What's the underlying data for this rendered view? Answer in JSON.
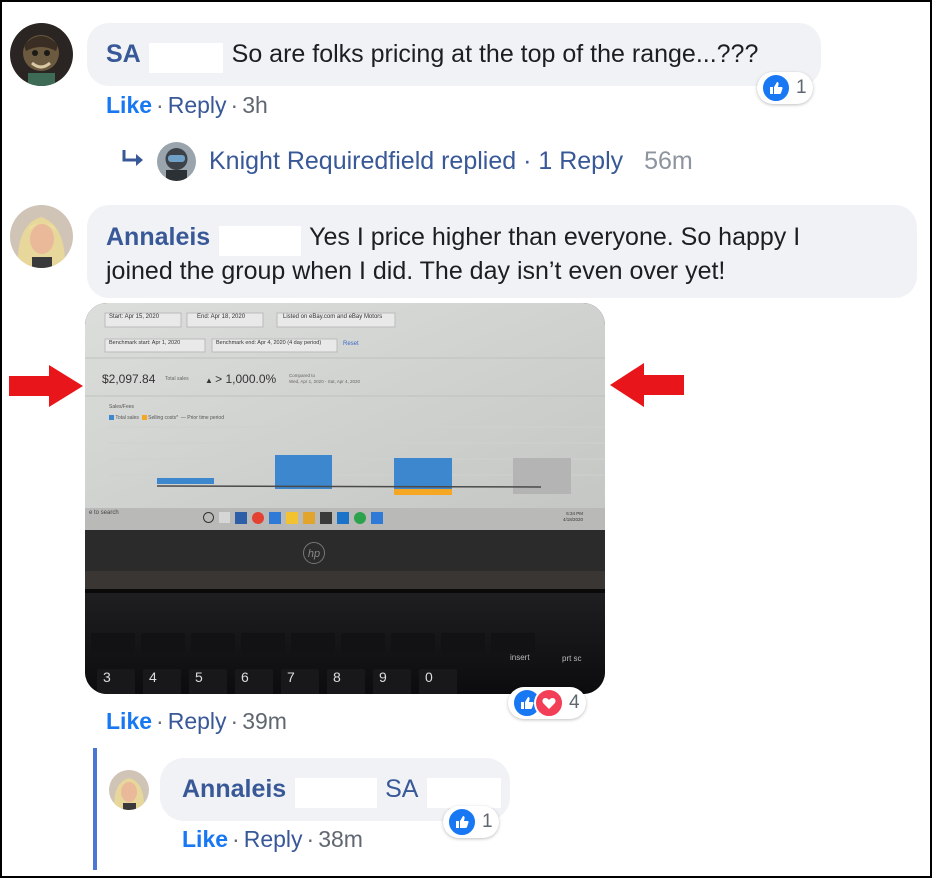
{
  "comments": [
    {
      "name": "SA",
      "text": "So are folks pricing at the top of the range...???",
      "like_label": "Like",
      "reply_label": "Reply",
      "time": "3h",
      "reaction_count": "1"
    },
    {
      "name": "Annaleis",
      "text_line1": "Yes I price higher than everyone. So happy I",
      "text_line2": "joined the group when I did. The day isn’t even over yet!",
      "like_label": "Like",
      "reply_label": "Reply",
      "time": "39m",
      "reaction_count": "4"
    }
  ],
  "reply_summary": {
    "text": "Knight Requiredfield replied · 1 Reply",
    "time": "56m"
  },
  "nested_reply": {
    "name": "Annaleis",
    "tag": "SA",
    "like_label": "Like",
    "reply_label": "Reply",
    "time": "38m",
    "reaction_count": "1"
  },
  "photo": {
    "start_label": "Start: Apr 15, 2020",
    "end_label": "End: Apr 18, 2020",
    "listed_label": "Listed on eBay.com and eBay Motors",
    "benchmark_start": "Benchmark start: Apr 1, 2020",
    "benchmark_end": "Benchmark end: Apr 4, 2020 (4 day period)",
    "reset_label": "Reset",
    "total_sales": "$2,097.84",
    "total_sales_caption": "Total sales",
    "change": "> 1,000.0%",
    "compared_line1": "Compared to",
    "compared_line2": "Wed, Apr 1, 2020 - Sat, Apr 4, 2020",
    "chart_heading": "Sales/Fees",
    "legend_total": "Total sales",
    "legend_selling": "Selling costs*",
    "legend_prior": "Prior time period",
    "search_hint": "e to search",
    "clock_time": "5:34 PM",
    "clock_date": "4/18/2020",
    "brand": "hp",
    "keys": [
      "3",
      "4",
      "5",
      "6",
      "7",
      "8",
      "9",
      "0"
    ],
    "key_shift_symbols": [
      "#",
      "$",
      "%",
      "&",
      "(",
      ")"
    ],
    "key_top": [
      "insert",
      "prt sc"
    ]
  },
  "colors": {
    "link": "#385898",
    "like": "#1877f2",
    "bubble": "#f0f2f5",
    "arrow": "#e8161a",
    "chart_blue": "#3c87cd",
    "chart_orange": "#f5a623"
  }
}
